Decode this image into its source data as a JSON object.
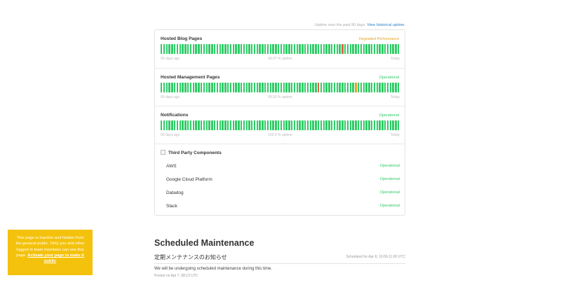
{
  "uptime_note": {
    "text": "Uptime over the past 90 days.",
    "link": "View historical uptime."
  },
  "colors": {
    "operational": "#2fcc66",
    "degraded": "#e3a322",
    "outage": "#e05d44",
    "link": "#2f80c6",
    "notice": "#f4c20d"
  },
  "components": [
    {
      "name": "Hosted Blog Pages",
      "status": "Degraded Performance",
      "status_color": "#e3a322",
      "footer_left": "90 days ago",
      "footer_center": "99.97 % uptime",
      "footer_right": "Today",
      "bar_count": 90,
      "incident_days": [
        {
          "index": 68,
          "severity": "outage"
        }
      ]
    },
    {
      "name": "Hosted Management Pages",
      "status": "Operational",
      "status_color": "#2fcc66",
      "footer_left": "90 days ago",
      "footer_center": "99.93 % uptime",
      "footer_right": "Today",
      "bar_count": 90,
      "incident_days": [
        {
          "index": 59,
          "severity": "outage"
        },
        {
          "index": 73,
          "severity": "degraded"
        }
      ]
    },
    {
      "name": "Notifications",
      "status": "Operational",
      "status_color": "#2fcc66",
      "footer_left": "90 days ago",
      "footer_center": "100.0 % uptime",
      "footer_right": "Today",
      "bar_count": 90,
      "incident_days": []
    }
  ],
  "third_party": {
    "title": "Third Party Components",
    "items": [
      {
        "name": "AWS",
        "status": "Operational"
      },
      {
        "name": "Google Cloud Platform",
        "status": "Operational"
      },
      {
        "name": "Datadog",
        "status": "Operational"
      },
      {
        "name": "Slack",
        "status": "Operational"
      }
    ]
  },
  "scheduled": {
    "title": "Scheduled Maintenance",
    "incident": {
      "name": "定期メンテナンスのお知らせ",
      "when": "Scheduled for Apr 8, 10:00-11:00 UTC",
      "body": "We will be undergoing scheduled maintenance during this time.",
      "posted": "Posted on Apr 7, 08:13 UTC"
    }
  },
  "notice": {
    "text": "This page is inactive and hidden from the general public. Only you and other logged in team members can see this page.",
    "link": "Activate your page to make it public"
  }
}
